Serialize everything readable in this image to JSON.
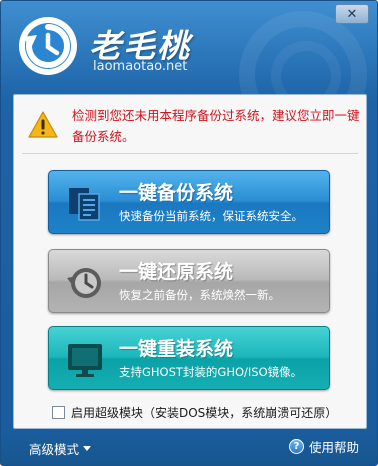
{
  "window": {
    "logo_title": "老毛桃",
    "logo_url": "laomaotao.net",
    "close_symbol": "✕"
  },
  "warning": {
    "icon": "warning-triangle-icon",
    "text": "检测到您还未用本程序备份过系统，建议您立即一键备份系统。"
  },
  "actions": [
    {
      "title": "一键备份系统",
      "subtitle": "快速备份当前系统，保证系统安全。",
      "icon": "document-copy-icon",
      "color": "#2b8ed4"
    },
    {
      "title": "一键还原系统",
      "subtitle": "恢复之前备份，系统焕然一新。",
      "icon": "clock-restore-icon",
      "color": "#b9b9b9"
    },
    {
      "title": "一键重装系统",
      "subtitle": "支持GHOST封装的GHO/ISO镜像。",
      "icon": "monitor-icon",
      "color": "#1cb6bb"
    }
  ],
  "option": {
    "label": "启用超级模块（安装DOS模块，系统崩溃可还原）",
    "checked": false
  },
  "footer": {
    "advanced_mode": "高级模式",
    "help": "使用帮助"
  }
}
